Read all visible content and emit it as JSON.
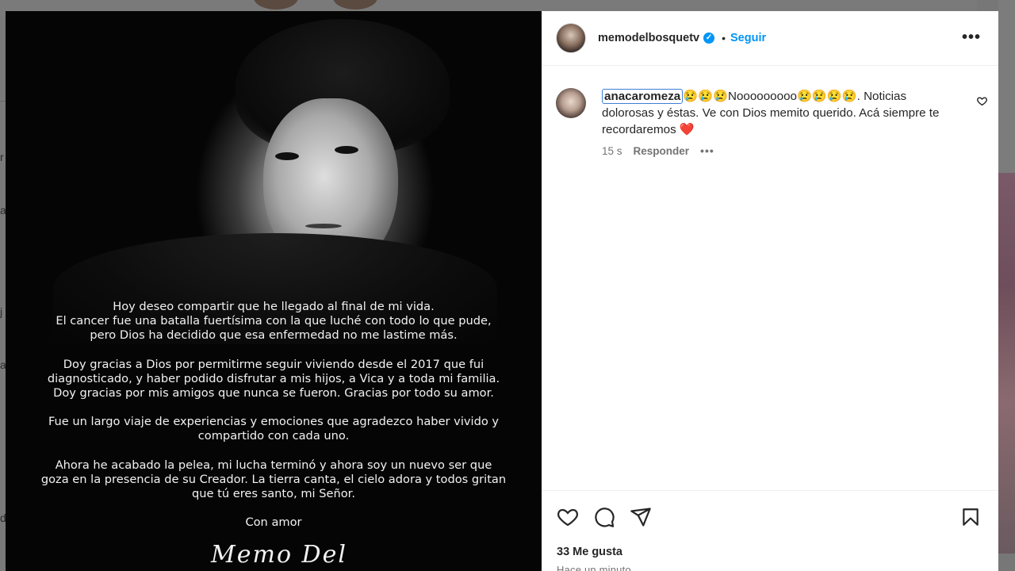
{
  "background": {
    "edge_letters": [
      "r",
      "a",
      "j",
      "a",
      "d"
    ]
  },
  "post": {
    "letter_paragraphs": [
      [
        "Hoy deseo compartir que he llegado al final de mi vida.",
        "El cancer fue una batalla fuertísima con la que luché con todo lo que pude,",
        "pero Dios ha decidido que esa enfermedad no me lastime más."
      ],
      [
        "Doy gracias a Dios por permitirme seguir viviendo desde el 2017 que fui",
        "diagnosticado, y haber podido disfrutar a mis hijos, a Vica y a toda mi familia.",
        "Doy gracias por mis amigos que nunca se fueron. Gracias por todo su amor."
      ],
      [
        "Fue un largo viaje de experiencias y emociones que agradezco haber vivido y",
        "compartido con cada uno."
      ],
      [
        "Ahora he acabado la pelea, mi lucha terminó y ahora soy un nuevo ser que",
        "goza en la presencia de su Creador.  La tierra canta, el cielo adora y todos gritan",
        "que tú eres santo, mi Señor."
      ]
    ],
    "closing": "Con amor",
    "signature": "Memo Del Bosque"
  },
  "header": {
    "username": "memodelbosquetv",
    "verified_glyph": "✓",
    "separator": "•",
    "follow_label": "Seguir",
    "more_label": "•••"
  },
  "comment": {
    "user": "anacaromeza",
    "emoji_a": "😢😢😢",
    "text_a": "Nooooooooo",
    "emoji_b": "😢😢😢😢",
    "text_b": ". Noticias dolorosas y éstas. Ve con Dios memito querido. Acá siempre te recordaremos ",
    "heart": "❤️",
    "time": "15 s",
    "reply_label": "Responder",
    "more_label": "•••"
  },
  "footer": {
    "likes": "33 Me gusta",
    "posted": "Hace un minuto"
  },
  "icons": [
    "heart-icon",
    "comment-icon",
    "share-icon",
    "bookmark-icon",
    "verified-badge-icon"
  ]
}
